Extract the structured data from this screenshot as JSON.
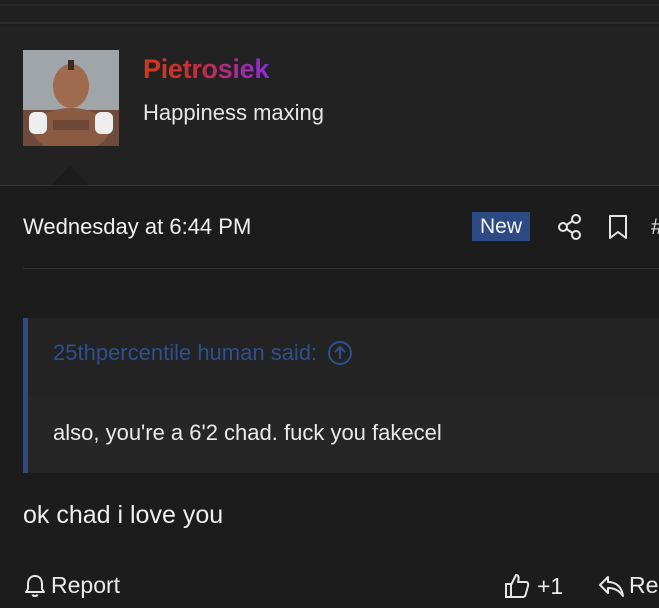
{
  "user": {
    "name": "Pietrosiek",
    "title": "Happiness maxing",
    "avatar_alt": "avatar",
    "name_gradient": [
      "#d33a1a",
      "#8a2be2"
    ]
  },
  "post": {
    "date": "Wednesday at 6:44 PM",
    "badge": "New",
    "badge_color": "#2d4a85",
    "actions": [
      "share-icon",
      "bookmark-icon",
      "more-icon"
    ]
  },
  "quote": {
    "author": "25thpercentile human said:",
    "text": "also, you're a 6'2 chad. fuck you fakecel",
    "accent": "#2d4a85"
  },
  "message": {
    "text": "ok chad i love you"
  },
  "footer": {
    "report_label": "Report",
    "like_label": "+1",
    "reply_label": "Re"
  }
}
